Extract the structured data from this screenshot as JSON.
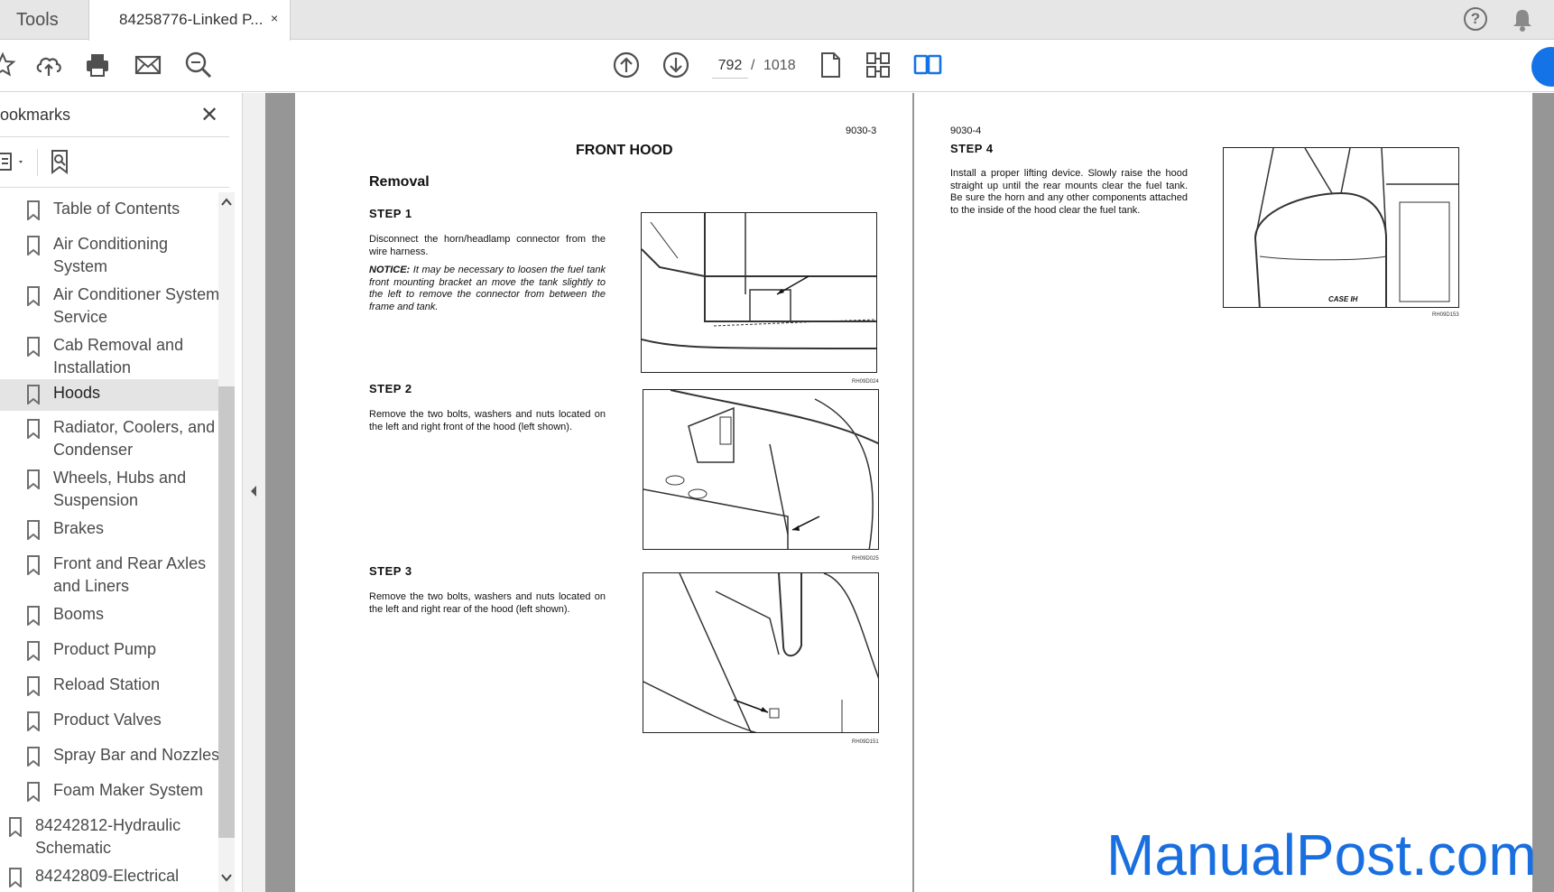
{
  "tabs": {
    "tools_label": "Tools",
    "document_label": "84258776-Linked P...",
    "close_glyph": "×"
  },
  "toolbar": {
    "icons": [
      "star-icon",
      "upload-cloud-icon",
      "print-icon",
      "mail-icon",
      "zoom-search-icon",
      "page-up-icon",
      "page-down-icon",
      "single-page-icon",
      "page-thumbnails-icon",
      "two-page-view-icon"
    ],
    "current_page": "792",
    "page_separator": "/",
    "total_pages": "1018"
  },
  "sidebar": {
    "title": "ookmarks",
    "close_glyph": "✕",
    "items": [
      {
        "label": "Table of Contents",
        "active": false
      },
      {
        "label": "Air Conditioning System",
        "active": false
      },
      {
        "label": "Air Conditioner System Service",
        "active": false
      },
      {
        "label": "Cab Removal and Installation",
        "active": false
      },
      {
        "label": "Hoods",
        "active": true
      },
      {
        "label": "Radiator, Coolers, and Condenser",
        "active": false
      },
      {
        "label": "Wheels, Hubs and Suspension",
        "active": false
      },
      {
        "label": "Brakes",
        "active": false
      },
      {
        "label": "Front and Rear Axles and Liners",
        "active": false
      },
      {
        "label": "Booms",
        "active": false
      },
      {
        "label": "Product Pump",
        "active": false
      },
      {
        "label": "Reload Station",
        "active": false
      },
      {
        "label": "Product Valves",
        "active": false
      },
      {
        "label": "Spray Bar and Nozzles",
        "active": false
      },
      {
        "label": "Foam Maker System",
        "active": false
      }
    ],
    "top_items": [
      {
        "label": "84242812-Hydraulic Schematic"
      },
      {
        "label": "84242809-Electrical"
      }
    ]
  },
  "left_page": {
    "page_number": "9030-3",
    "title": "FRONT HOOD",
    "section": "Removal",
    "steps": [
      {
        "heading": "STEP  1",
        "text": "Disconnect the horn/headlamp connector from the wire harness.",
        "notice_label": "NOTICE:",
        "notice": " It may be necessary to loosen the fuel tank front mounting bracket an move the tank slightly to the left to remove the connector from between the frame and tank.",
        "figure_code": "RH09D024"
      },
      {
        "heading": "STEP  2",
        "text": "Remove the two bolts, washers and nuts located on the left and right front of the hood (left shown).",
        "figure_code": "RH09D025"
      },
      {
        "heading": "STEP  3",
        "text": "Remove the two bolts, washers and nuts located on the left and right rear of the hood (left shown).",
        "figure_code": "RH09D151"
      }
    ]
  },
  "right_page": {
    "page_number": "9030-4",
    "step": {
      "heading": "STEP  4",
      "text": "Install a proper lifting device. Slowly raise the hood straight up until the rear mounts clear the fuel tank. Be sure the horn and any other components attached to the inside of the hood clear the fuel tank.",
      "figure_code": "RH09D153",
      "logo_text": "CASE IH"
    }
  },
  "watermark": "ManualPost.com"
}
